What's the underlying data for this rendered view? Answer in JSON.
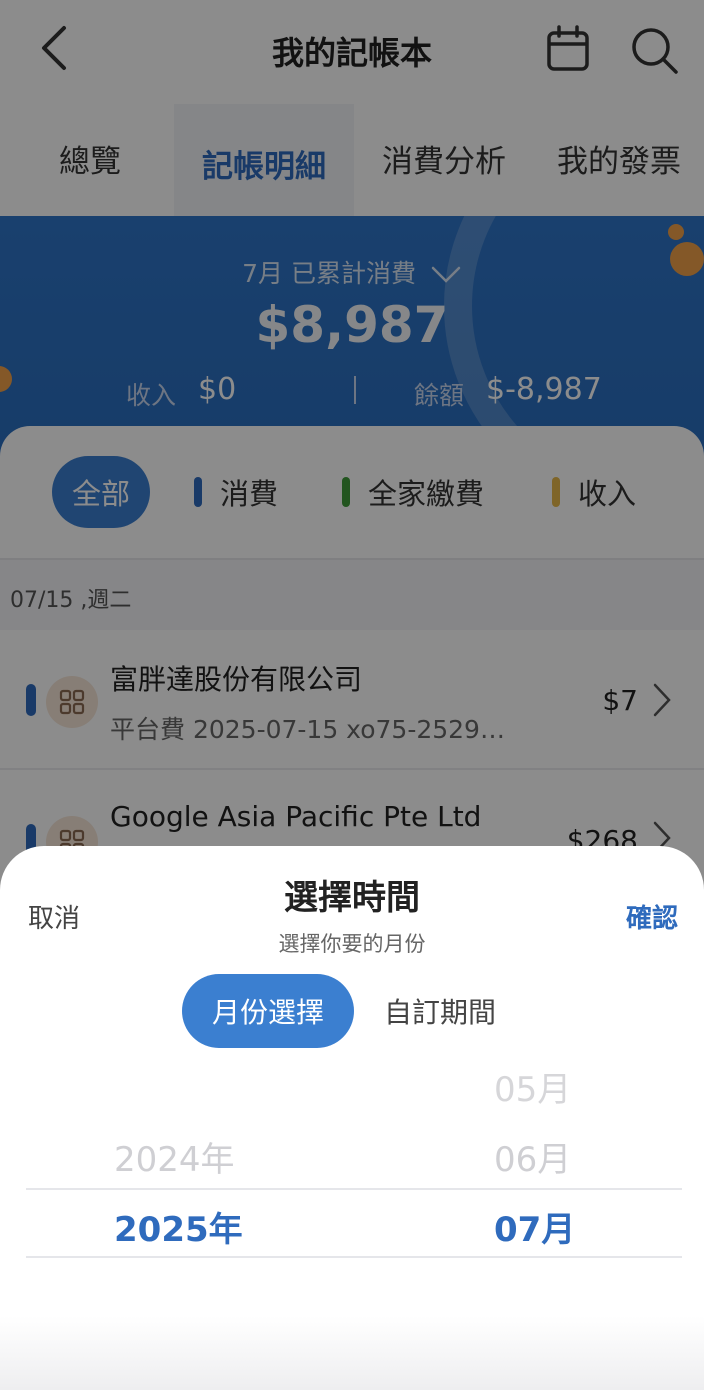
{
  "header": {
    "title": "我的記帳本"
  },
  "tabs": [
    {
      "label": "總覽"
    },
    {
      "label": "記帳明細"
    },
    {
      "label": "消費分析"
    },
    {
      "label": "我的發票"
    }
  ],
  "summary": {
    "month_label": "7月 已累計消費",
    "total": "$8,987",
    "income_label": "收入",
    "income_value": "$0",
    "balance_label": "餘額",
    "balance_value": "$-8,987"
  },
  "filters": [
    {
      "label": "全部"
    },
    {
      "label": "消費",
      "color": "#2f6bbd"
    },
    {
      "label": "全家繳費",
      "color": "#3f9b3a"
    },
    {
      "label": "收入",
      "color": "#e8b94a"
    }
  ],
  "date_group": "07/15 ,週二",
  "transactions": [
    {
      "merchant": "富胖達股份有限公司",
      "desc": "平台費 2025-07-15 xo75-2529…",
      "amount": "$7"
    },
    {
      "merchant": "Google Asia Pacific Pte Ltd",
      "amount": "$268"
    }
  ],
  "sheet": {
    "cancel": "取消",
    "confirm": "確認",
    "title": "選擇時間",
    "subtitle": "選擇你要的月份",
    "mode_active": "月份選擇",
    "mode_other": "自訂期間",
    "years": [
      "2024年",
      "2025年"
    ],
    "months": [
      "05月",
      "06月",
      "07月"
    ]
  },
  "colors": {
    "accent": "#2f6bbd",
    "banner": "#2f75c8"
  }
}
